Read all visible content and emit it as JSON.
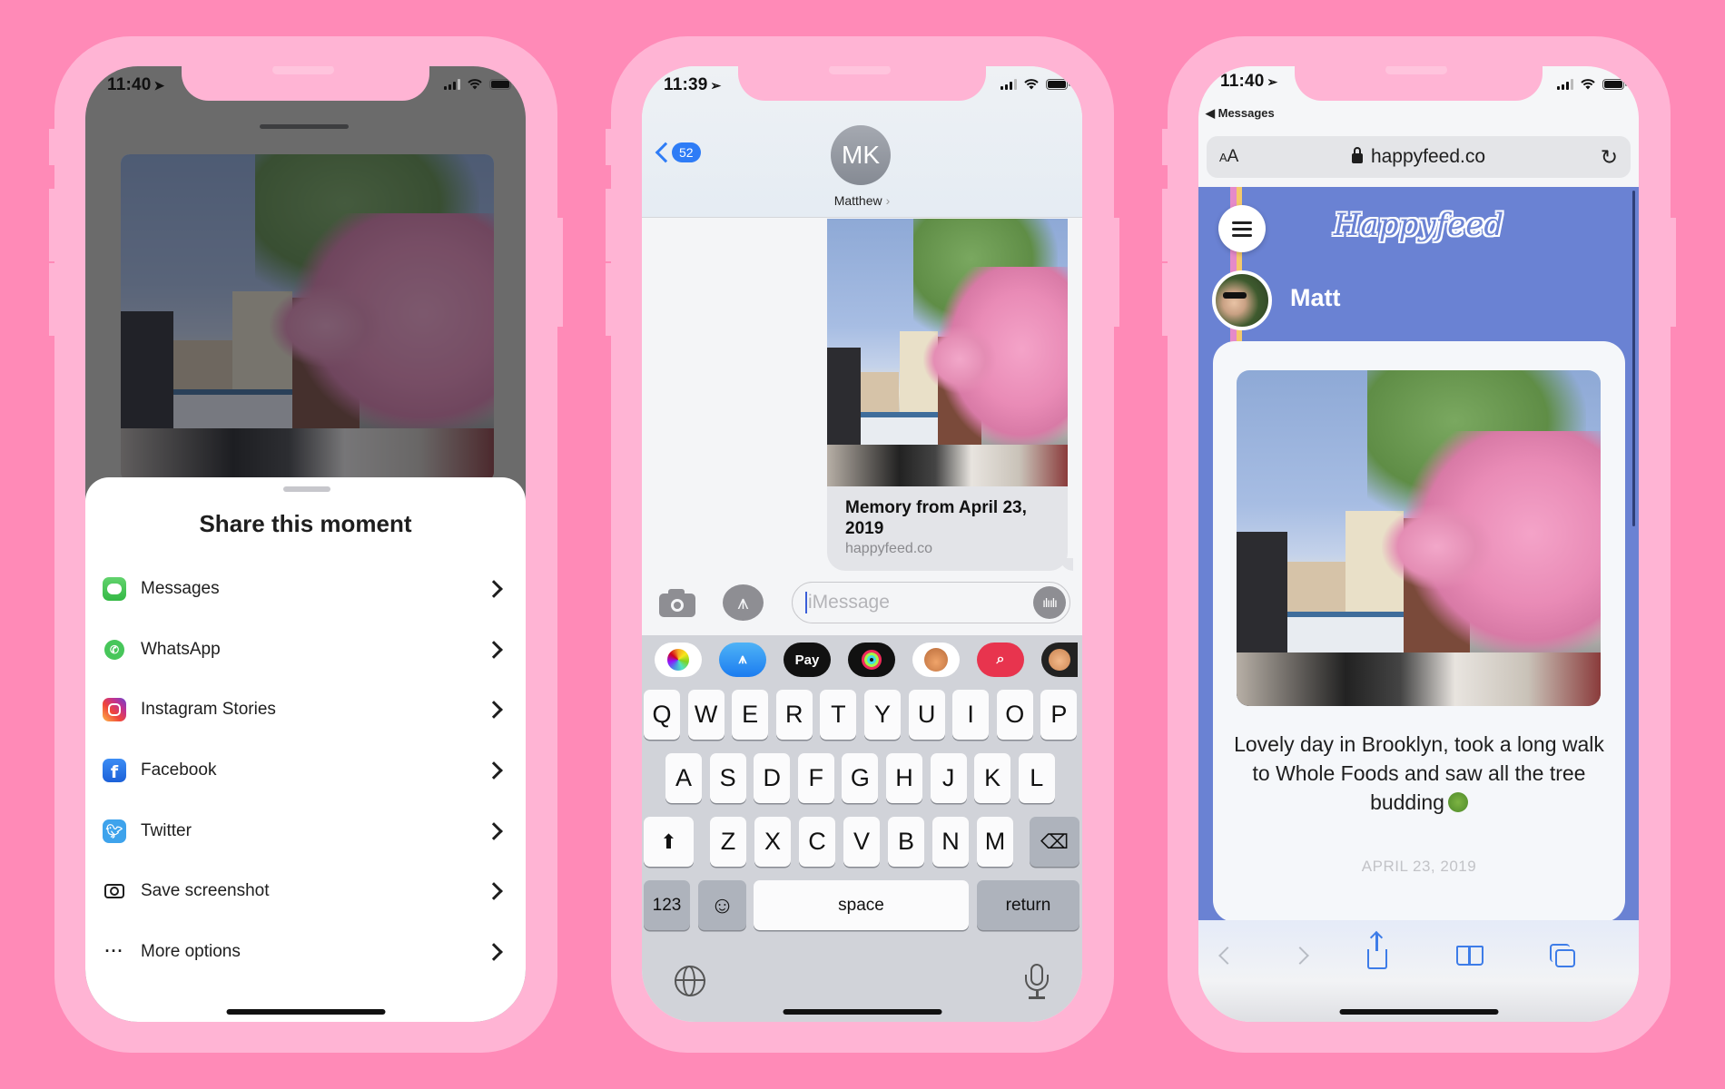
{
  "theme": {
    "background": "#ff8ab7",
    "phone_frame": "#ffb4d4",
    "ios_blue": "#2e7cf6",
    "happyfeed_blue": "#6a82d3"
  },
  "phone1": {
    "status": {
      "time": "11:40",
      "location_icon": "location-arrow-icon"
    },
    "photo_alt": "Cherry blossom tree over a Brooklyn street",
    "sheet": {
      "title": "Share this moment",
      "items": [
        {
          "label": "Messages",
          "icon": "messages-icon"
        },
        {
          "label": "WhatsApp",
          "icon": "whatsapp-icon"
        },
        {
          "label": "Instagram Stories",
          "icon": "instagram-icon"
        },
        {
          "label": "Facebook",
          "icon": "facebook-icon"
        },
        {
          "label": "Twitter",
          "icon": "twitter-icon"
        },
        {
          "label": "Save screenshot",
          "icon": "camera-icon"
        },
        {
          "label": "More options",
          "icon": "ellipsis-icon"
        }
      ]
    }
  },
  "phone2": {
    "status": {
      "time": "11:39"
    },
    "header": {
      "back_badge": "52",
      "avatar_initials": "MK",
      "contact_name": "Matthew",
      "contact_arrow": "›"
    },
    "link_preview": {
      "title": "Memory from April 23, 2019",
      "domain": "happyfeed.co"
    },
    "compose": {
      "placeholder": "iMessage"
    },
    "app_strip": [
      {
        "name": "photos-app"
      },
      {
        "name": "app-store-app"
      },
      {
        "name": "apple-pay-app",
        "label": "Pay"
      },
      {
        "name": "activity-app"
      },
      {
        "name": "memoji-stickers-app"
      },
      {
        "name": "images-search-app"
      },
      {
        "name": "animoji-app"
      }
    ],
    "keyboard": {
      "row1": [
        "Q",
        "W",
        "E",
        "R",
        "T",
        "Y",
        "U",
        "I",
        "O",
        "P"
      ],
      "row2": [
        "A",
        "S",
        "D",
        "F",
        "G",
        "H",
        "J",
        "K",
        "L"
      ],
      "row3": [
        "Z",
        "X",
        "C",
        "V",
        "B",
        "N",
        "M"
      ],
      "numbers_label": "123",
      "space_label": "space",
      "return_label": "return"
    }
  },
  "phone3": {
    "status": {
      "time": "11:40",
      "back_app": "◀ Messages"
    },
    "url_bar": {
      "text_size_label": "AA",
      "url": "happyfeed.co"
    },
    "page": {
      "logo": "Happyfeed",
      "user_name": "Matt",
      "post": {
        "caption": "Lovely day in Brooklyn, took a long walk to Whole Foods and saw all the tree budding",
        "date": "APRIL 23, 2019"
      }
    },
    "toolbar": [
      "back",
      "forward",
      "share",
      "bookmarks",
      "tabs"
    ]
  }
}
